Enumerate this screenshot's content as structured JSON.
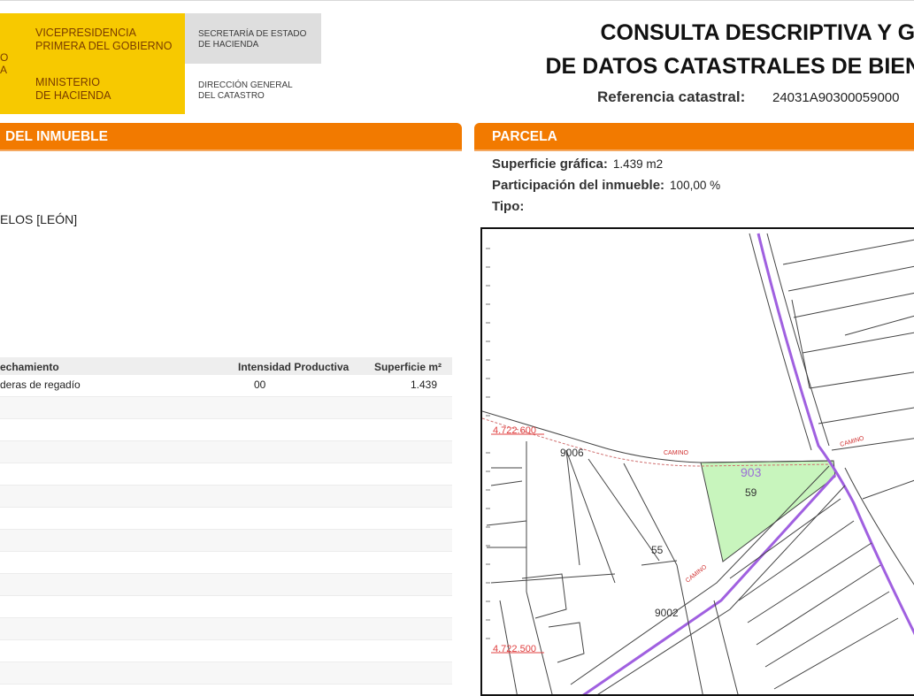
{
  "logo": {
    "crest_line1": "O",
    "crest_line2": "A",
    "vice_line1": "VICEPRESIDENCIA",
    "vice_line2": "PRIMERA DEL GOBIERNO",
    "min_line1": "MINISTERIO",
    "min_line2": "DE HACIENDA",
    "sec_line1": "SECRETARÍA DE ESTADO",
    "sec_line2": "DE HACIENDA",
    "dir_line1": "DIRECCIÓN GENERAL",
    "dir_line2": "DEL CATASTRO"
  },
  "header": {
    "title_line1": "CONSULTA DESCRIPTIVA Y GI",
    "title_line2": "DE DATOS CATASTRALES DE BIEN",
    "refcat_label": "Referencia catastral:",
    "refcat_value": "24031A90300059000"
  },
  "inmueble": {
    "section_title": "DEL INMUEBLE",
    "municipio": "ELOS [LEÓN]"
  },
  "cultivos": {
    "headers": [
      "echamiento",
      "Intensidad Productiva",
      "Superficie m²"
    ],
    "rows": [
      [
        "deras de regadío",
        "00",
        "1.439"
      ],
      [
        "",
        "",
        ""
      ],
      [
        "",
        "",
        ""
      ],
      [
        "",
        "",
        ""
      ],
      [
        "",
        "",
        ""
      ],
      [
        "",
        "",
        ""
      ],
      [
        "",
        "",
        ""
      ],
      [
        "",
        "",
        ""
      ],
      [
        "",
        "",
        ""
      ],
      [
        "",
        "",
        ""
      ],
      [
        "",
        "",
        ""
      ],
      [
        "",
        "",
        ""
      ],
      [
        "",
        "",
        ""
      ],
      [
        "",
        "",
        ""
      ]
    ]
  },
  "parcela": {
    "section_title": "PARCELA",
    "superficie_label": "Superficie gráfica:",
    "superficie_value": "1.439 m2",
    "participacion_label": "Participación del inmueble:",
    "participacion_value": "100,00 %",
    "tipo_label": "Tipo:"
  },
  "map": {
    "labels": {
      "coord_top": "4.722.600",
      "coord_bottom": "4.722.500",
      "road_9006": "9006",
      "camino_1": "CAMINO",
      "camino_2": "CAMINO",
      "camino_3": "CAMINO",
      "poligono": "903",
      "parcel_59": "59",
      "parcel_55": "55",
      "road_9002": "9002"
    },
    "colors": {
      "highlight_fill": "#c8f5bd",
      "road_purple": "#a060e0",
      "coord_red": "#e04040",
      "camino_red": "#d03030"
    }
  }
}
